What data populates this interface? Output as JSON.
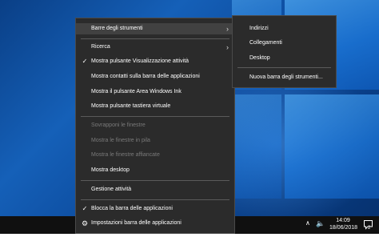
{
  "main_menu": {
    "items": [
      {
        "label": "Barre degli strumenti",
        "submenu": true
      },
      {
        "label": "Ricerca",
        "submenu": true
      },
      {
        "label": "Mostra pulsante Visualizzazione attività",
        "checked": true
      },
      {
        "label": "Mostra contatti sulla barra delle applicazioni"
      },
      {
        "label": "Mostra il pulsante Area Windows Ink"
      },
      {
        "label": "Mostra pulsante tastiera virtuale"
      },
      {
        "label": "Sovrapponi le finestre",
        "disabled": true
      },
      {
        "label": "Mostra le finestre in pila",
        "disabled": true
      },
      {
        "label": "Mostra le finestre affiancate",
        "disabled": true
      },
      {
        "label": "Mostra desktop"
      },
      {
        "label": "Gestione attività"
      },
      {
        "label": "Blocca la barra delle applicazioni",
        "checked": true
      },
      {
        "label": "Impostazioni barra delle applicazioni",
        "icon": "gear-icon"
      }
    ]
  },
  "sub_menu": {
    "items": [
      {
        "label": "Indirizzi"
      },
      {
        "label": "Collegamenti"
      },
      {
        "label": "Desktop"
      },
      {
        "label": "Nuova barra degli strumenti..."
      }
    ]
  },
  "glyphs": {
    "check": "✓",
    "chevron": "›",
    "gear": "⚙",
    "tray_caret": "∧",
    "speaker": "🔈"
  },
  "taskbar": {
    "time": "14:09",
    "date": "18/06/2018",
    "notification_count": "2"
  },
  "colors": {
    "menu_background": "#2b2b2b",
    "menu_highlight": "#414141",
    "disabled_text": "#7a7a7a",
    "taskbar": "#101010"
  }
}
